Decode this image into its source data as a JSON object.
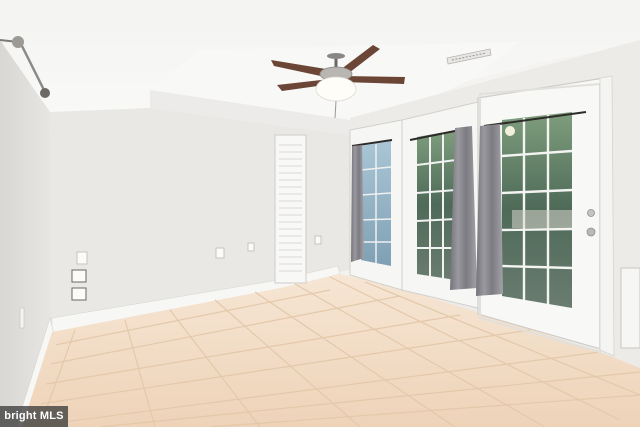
{
  "image": {
    "subject": "empty-room-interior",
    "watermark": "bright MLS",
    "colors": {
      "wall": "#ebe9e6",
      "ceiling": "#f6f6f4",
      "floor_tile": "#f0d6bc",
      "grout": "#e3c6a8",
      "door_frame": "#f7f7f5",
      "curtain": "#8b8a90",
      "glass": "#5a7a68",
      "fan_blade": "#6b4636"
    }
  }
}
